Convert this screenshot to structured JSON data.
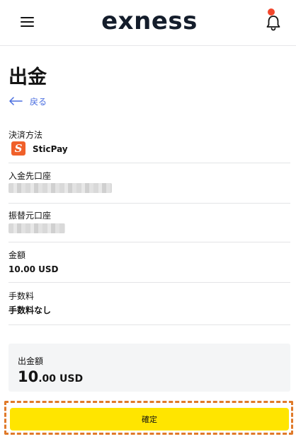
{
  "header": {
    "logo_text": "exness",
    "menu_icon": "hamburger-menu-icon",
    "notification_icon": "bell-icon",
    "notification_dot_color": "#f2462c"
  },
  "page": {
    "title": "出金",
    "back_label": "戻る",
    "back_icon": "arrow-left-icon"
  },
  "details": {
    "payment_method_label": "決済方法",
    "payment_method_value": "SticPay",
    "payment_method_icon": "sticpay-logo-icon",
    "deposit_account_label": "入金先口座",
    "deposit_account_value": "",
    "source_account_label": "振替元口座",
    "source_account_value": "",
    "amount_label": "金額",
    "amount_value": "10.00 USD",
    "fee_label": "手数料",
    "fee_value": "手数料なし"
  },
  "summary": {
    "label": "出金額",
    "amount_integer": "10",
    "amount_fraction": ".00",
    "currency": "USD"
  },
  "actions": {
    "confirm_label": "確定",
    "confirm_color": "#ffe500",
    "highlight_color": "#e07a2a"
  }
}
